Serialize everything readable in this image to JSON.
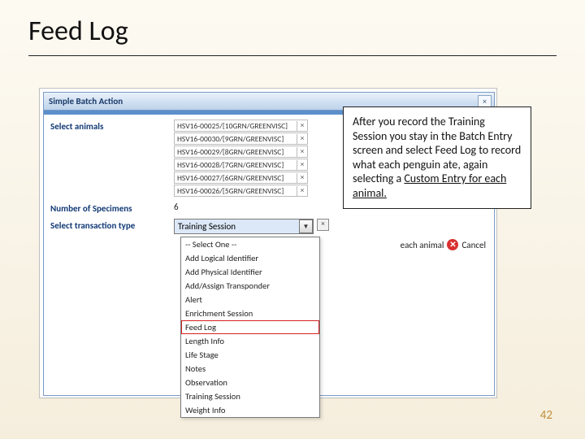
{
  "slide_title": "Feed Log",
  "page_number": "42",
  "dialog": {
    "title": "Simple Batch Action",
    "close_glyph": "×",
    "fields": {
      "select_animals": "Select animals",
      "num_specimens": "Number of Specimens",
      "trans_type": "Select transaction type"
    },
    "animals": [
      "HSV16-00025/[10GRN/GREENVISC]",
      "HSV16-00030/[9GRN/GREENVISC]",
      "HSV16-00029/[8GRN/GREENVISC]",
      "HSV16-00028/[7GRN/GREENVISC]",
      "HSV16-00027/[6GRN/GREENVISC]",
      "HSV16-00026/[5GRN/GREENVISC]"
    ],
    "specimen_count": "6",
    "combo_value": "Training Session",
    "dropdown_options": [
      "-- Select One --",
      "Add Logical Identifier",
      "Add Physical Identifier",
      "Add/Assign Transponder",
      "Alert",
      "Enrichment Session",
      "Feed Log",
      "Length Info",
      "Life Stage",
      "Notes",
      "Observation",
      "Training Session",
      "Weight Info"
    ],
    "highlight_option": "Feed Log",
    "action_bar": {
      "each_animal": "each animal",
      "cancel": "Cancel"
    }
  },
  "callout": {
    "text_prefix": "After you record the Training Session you stay in the Batch Entry screen and select Feed Log to record what each penguin ate, again selecting a ",
    "text_underlined": "Custom Entry for each animal."
  }
}
